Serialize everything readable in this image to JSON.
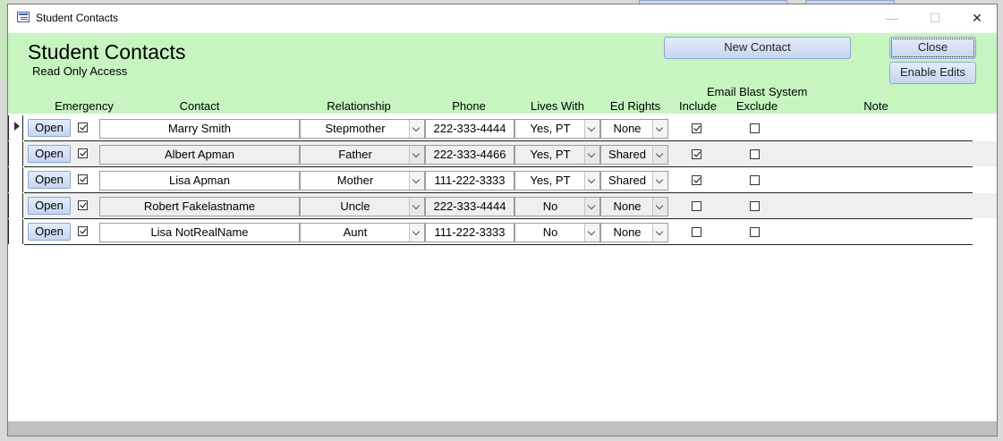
{
  "window": {
    "title": "Student Contacts",
    "minimize": "—",
    "maximize": "☐",
    "close": "✕"
  },
  "header": {
    "title": "Student Contacts",
    "subtitle": "Read Only Access",
    "new_contact": "New Contact",
    "close": "Close",
    "enable_edits": "Enable Edits"
  },
  "columns": {
    "emergency": "Emergency",
    "contact": "Contact",
    "relationship": "Relationship",
    "phone": "Phone",
    "lives_with": "Lives With",
    "ed_rights": "Ed Rights",
    "email_blast_1": "Email Blast",
    "email_blast_2": "Include",
    "system_1": "System",
    "system_2": "Exclude",
    "note": "Note"
  },
  "rows": [
    {
      "open": "Open",
      "emergency": true,
      "contact": "Marry Smith",
      "relationship": "Stepmother",
      "phone": "222-333-4444",
      "lives_with": "Yes, PT",
      "ed_rights": "None",
      "email_include": true,
      "system_exclude": false,
      "note": ""
    },
    {
      "open": "Open",
      "emergency": true,
      "contact": "Albert Apman",
      "relationship": "Father",
      "phone": "222-333-4466",
      "lives_with": "Yes, PT",
      "ed_rights": "Shared",
      "email_include": true,
      "system_exclude": false,
      "note": ""
    },
    {
      "open": "Open",
      "emergency": true,
      "contact": "Lisa Apman",
      "relationship": "Mother",
      "phone": "111-222-3333",
      "lives_with": "Yes, PT",
      "ed_rights": "Shared",
      "email_include": true,
      "system_exclude": false,
      "note": ""
    },
    {
      "open": "Open",
      "emergency": true,
      "contact": "Robert Fakelastname",
      "relationship": "Uncle",
      "phone": "222-333-4444",
      "lives_with": "No",
      "ed_rights": "None",
      "email_include": false,
      "system_exclude": false,
      "note": ""
    },
    {
      "open": "Open",
      "emergency": true,
      "contact": "Lisa NotRealName",
      "relationship": "Aunt",
      "phone": "111-222-3333",
      "lives_with": "No",
      "ed_rights": "None",
      "email_include": false,
      "system_exclude": false,
      "note": ""
    }
  ],
  "colors": {
    "header_bg": "#c6f5c0",
    "button_bg": "#c6d6f0",
    "alt_row": "#efefef"
  }
}
